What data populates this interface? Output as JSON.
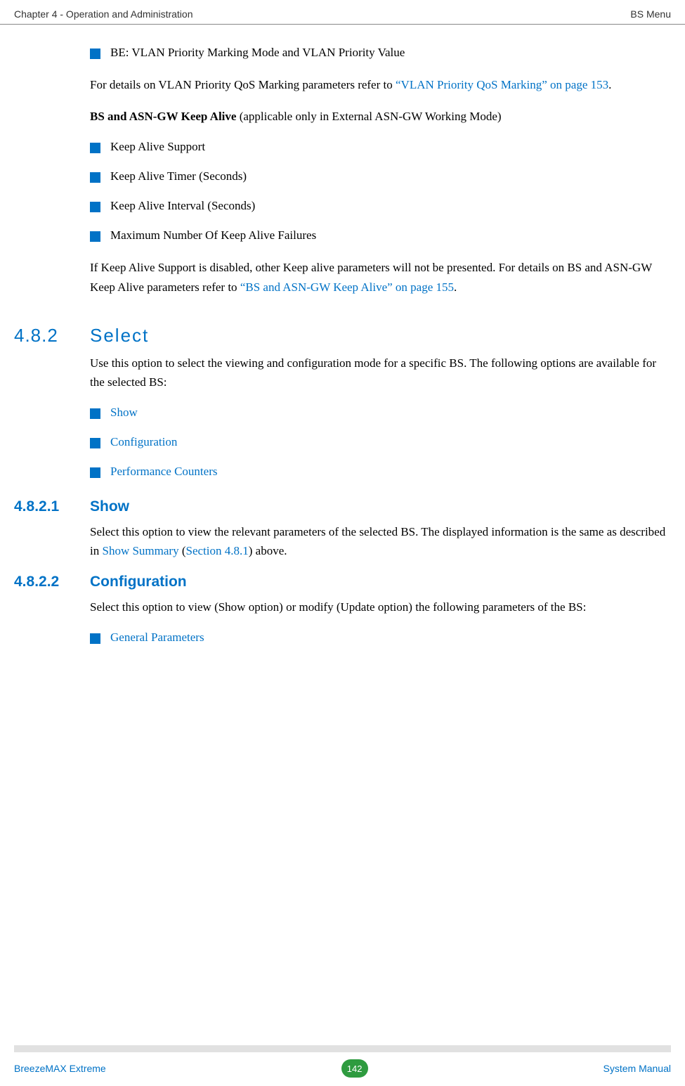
{
  "header": {
    "left": "Chapter 4 - Operation and Administration",
    "right": "BS Menu"
  },
  "body": {
    "bullets_a": [
      "BE: VLAN Priority Marking Mode and VLAN Priority Value"
    ],
    "para_a1_pre": "For details on VLAN Priority QoS Marking parameters refer to ",
    "para_a1_link": "“VLAN Priority QoS Marking” on page 153",
    "para_a1_post": ".",
    "para_b_bold": "BS and ASN-GW Keep Alive",
    "para_b_rest": " (applicable only in External ASN-GW Working Mode)",
    "bullets_b": [
      "Keep Alive Support",
      "Keep Alive Timer (Seconds)",
      "Keep Alive Interval (Seconds)",
      "Maximum Number Of Keep Alive Failures"
    ],
    "para_c_pre": "If Keep Alive Support is disabled, other Keep alive parameters will not be presented. For details on BS and ASN-GW Keep Alive parameters refer to ",
    "para_c_link": "“BS and ASN-GW Keep Alive” on page 155",
    "para_c_post": "."
  },
  "section_482": {
    "num": "4.8.2",
    "title": "Select",
    "para": "Use this option to select the viewing and configuration mode for a specific BS. The following options are available for the selected BS:",
    "bullets": [
      "Show",
      "Configuration",
      "Performance Counters"
    ]
  },
  "section_4821": {
    "num": "4.8.2.1",
    "title": "Show",
    "para_pre": "Select this option to view the relevant parameters of the selected BS. The displayed information is the same as described in ",
    "link1": "Show Summary",
    "mid": " (",
    "link2": "Section 4.8.1",
    "para_post": ") above."
  },
  "section_4822": {
    "num": "4.8.2.2",
    "title": "Configuration",
    "para": "Select this option to view (Show option) or modify (Update option) the following parameters of the BS:",
    "bullets": [
      "General Parameters"
    ]
  },
  "footer": {
    "left": "BreezeMAX Extreme",
    "page": "142",
    "right": "System Manual"
  }
}
